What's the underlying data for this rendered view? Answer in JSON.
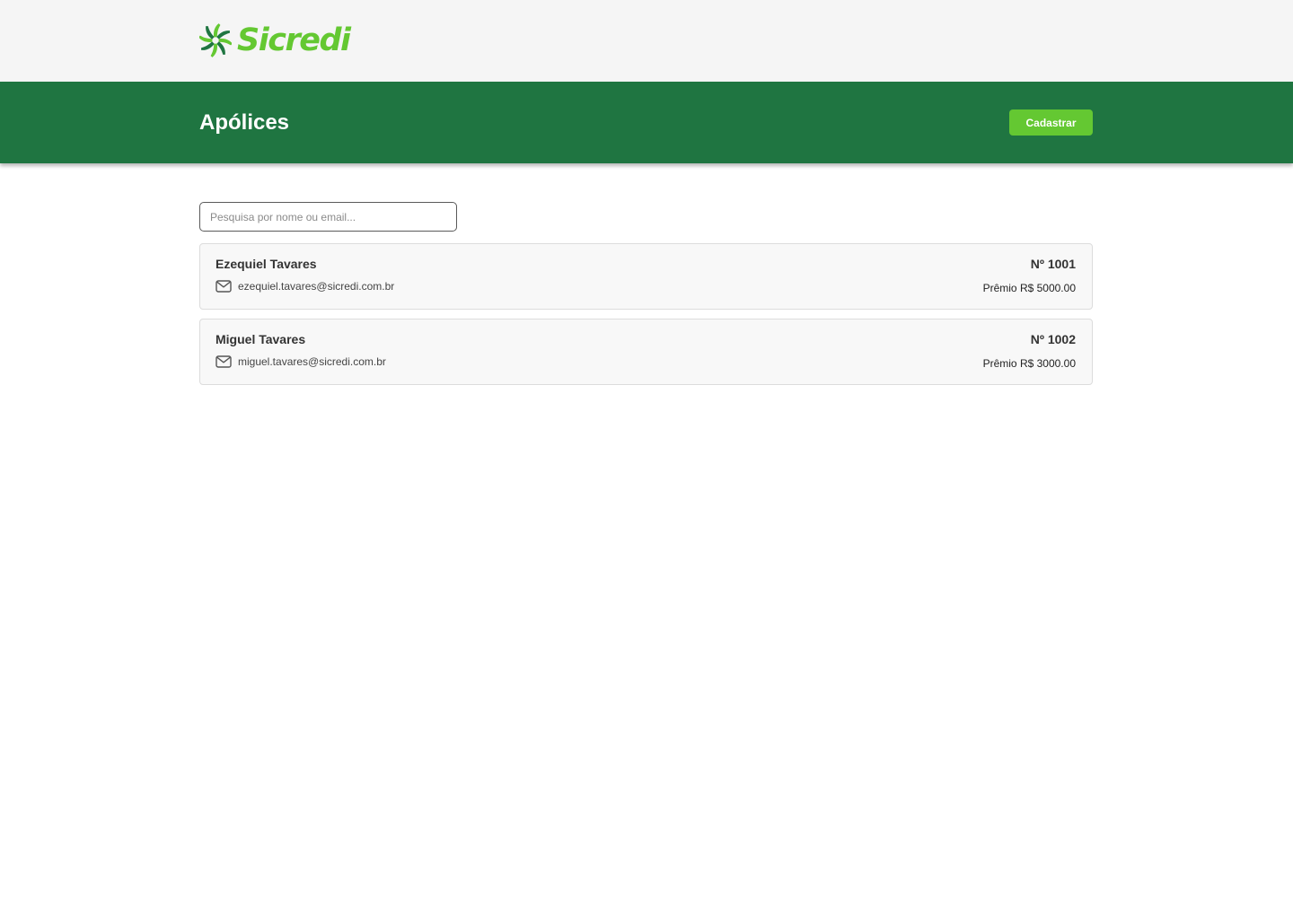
{
  "brand": {
    "name": "Sicredi",
    "color_primary": "#1f7541",
    "color_accent": "#64c832"
  },
  "header": {
    "title": "Apólices",
    "register_label": "Cadastrar"
  },
  "search": {
    "placeholder": "Pesquisa por nome ou email...",
    "value": ""
  },
  "policies": [
    {
      "name": "Ezequiel Tavares",
      "email": "ezequiel.tavares@sicredi.com.br",
      "number": "Nº 1001",
      "premium": "Prêmio R$ 5000.00",
      "icon": "mail-icon"
    },
    {
      "name": "Miguel Tavares",
      "email": "miguel.tavares@sicredi.com.br",
      "number": "Nº 1002",
      "premium": "Prêmio R$ 3000.00",
      "icon": "mail-icon"
    }
  ]
}
